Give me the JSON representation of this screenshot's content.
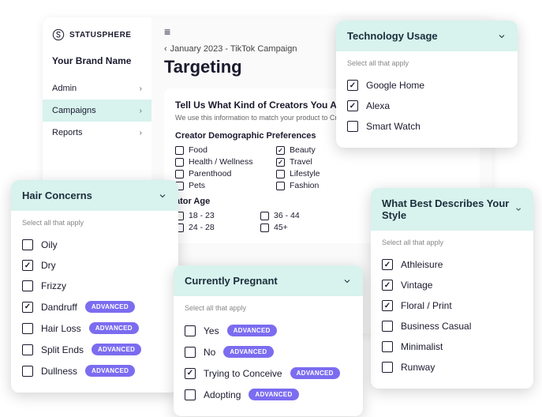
{
  "app": {
    "logo_text": "STATUSPHERE",
    "brand": "Your Brand Name",
    "nav": [
      {
        "label": "Admin",
        "active": false
      },
      {
        "label": "Campaigns",
        "active": true
      },
      {
        "label": "Reports",
        "active": false
      }
    ],
    "breadcrumb": "January 2023 - TikTok Campaign",
    "page_title": "Targeting",
    "card": {
      "heading": "Tell Us What Kind of Creators You Are Trying",
      "subtext": "We use this information to match your product to Creators for th",
      "demo_title": "Creator Demographic Preferences",
      "prefs": [
        {
          "label": "Food",
          "checked": false
        },
        {
          "label": "Beauty",
          "checked": true
        },
        {
          "label": "Health / Wellness",
          "checked": false
        },
        {
          "label": "Travel",
          "checked": true
        },
        {
          "label": "Parenthood",
          "checked": false
        },
        {
          "label": "Lifestyle",
          "checked": false
        },
        {
          "label": "Pets",
          "checked": false
        },
        {
          "label": "Fashion",
          "checked": false
        }
      ],
      "age_title": "ator Age",
      "ages": [
        {
          "label": "18 - 23",
          "checked": false
        },
        {
          "label": "36 - 44",
          "checked": false
        },
        {
          "label": "24 - 28",
          "checked": false
        },
        {
          "label": "45+",
          "checked": false
        }
      ]
    }
  },
  "hint": "Select all that apply",
  "badge": "ADVANCED",
  "panels": {
    "hair": {
      "title": "Hair Concerns",
      "options": [
        {
          "label": "Oily",
          "checked": false,
          "badge": false
        },
        {
          "label": "Dry",
          "checked": true,
          "badge": false
        },
        {
          "label": "Frizzy",
          "checked": false,
          "badge": false
        },
        {
          "label": "Dandruff",
          "checked": true,
          "badge": true
        },
        {
          "label": "Hair Loss",
          "checked": false,
          "badge": true
        },
        {
          "label": "Split Ends",
          "checked": false,
          "badge": true
        },
        {
          "label": "Dullness",
          "checked": false,
          "badge": true
        }
      ]
    },
    "tech": {
      "title": "Technology Usage",
      "options": [
        {
          "label": "Google Home",
          "checked": true,
          "badge": false
        },
        {
          "label": "Alexa",
          "checked": true,
          "badge": false
        },
        {
          "label": "Smart Watch",
          "checked": false,
          "badge": false
        }
      ]
    },
    "preg": {
      "title": "Currently Pregnant",
      "options": [
        {
          "label": "Yes",
          "checked": false,
          "badge": true
        },
        {
          "label": "No",
          "checked": false,
          "badge": true
        },
        {
          "label": "Trying to Conceive",
          "checked": true,
          "badge": true
        },
        {
          "label": "Adopting",
          "checked": false,
          "badge": true
        }
      ]
    },
    "style": {
      "title": "What Best Describes Your Style",
      "options": [
        {
          "label": "Athleisure",
          "checked": true,
          "badge": false
        },
        {
          "label": "Vintage",
          "checked": true,
          "badge": false
        },
        {
          "label": "Floral / Print",
          "checked": true,
          "badge": false
        },
        {
          "label": "Business Casual",
          "checked": false,
          "badge": false
        },
        {
          "label": "Minimalist",
          "checked": false,
          "badge": false
        },
        {
          "label": "Runway",
          "checked": false,
          "badge": false
        }
      ]
    }
  }
}
